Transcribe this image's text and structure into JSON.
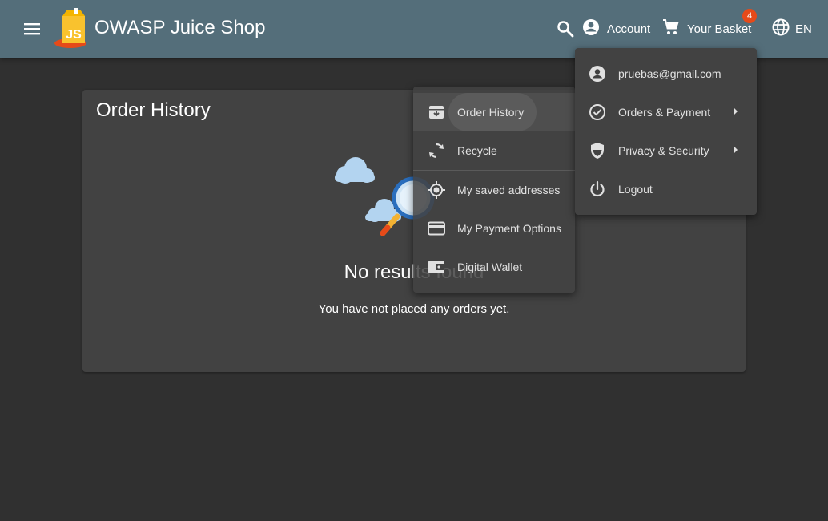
{
  "header": {
    "app_title": "OWASP Juice Shop",
    "logo_text": "JS",
    "account_label": "Account",
    "basket_label": "Your Basket",
    "basket_count": "4",
    "language_label": "EN",
    "toolbar_color": "#546e7a",
    "badge_color": "#e64a19"
  },
  "page": {
    "title": "Order History",
    "empty_title": "No results found",
    "empty_subtitle": "You have not placed any orders yet."
  },
  "account_menu": {
    "items": [
      {
        "label": "pruebas@gmail.com",
        "icon": "account-circle-icon"
      },
      {
        "label": "Orders & Payment",
        "icon": "check-circle-icon",
        "has_submenu": true
      },
      {
        "label": "Privacy & Security",
        "icon": "shield-icon",
        "has_submenu": true
      },
      {
        "label": "Logout",
        "icon": "power-icon"
      }
    ]
  },
  "orders_submenu": {
    "items": [
      {
        "label": "Order History",
        "icon": "archive-icon",
        "active": true
      },
      {
        "label": "Recycle",
        "icon": "recycle-icon"
      },
      {
        "label": "My saved addresses",
        "icon": "location-icon"
      },
      {
        "label": "My Payment Options",
        "icon": "credit-card-icon"
      },
      {
        "label": "Digital Wallet",
        "icon": "wallet-icon"
      }
    ]
  }
}
